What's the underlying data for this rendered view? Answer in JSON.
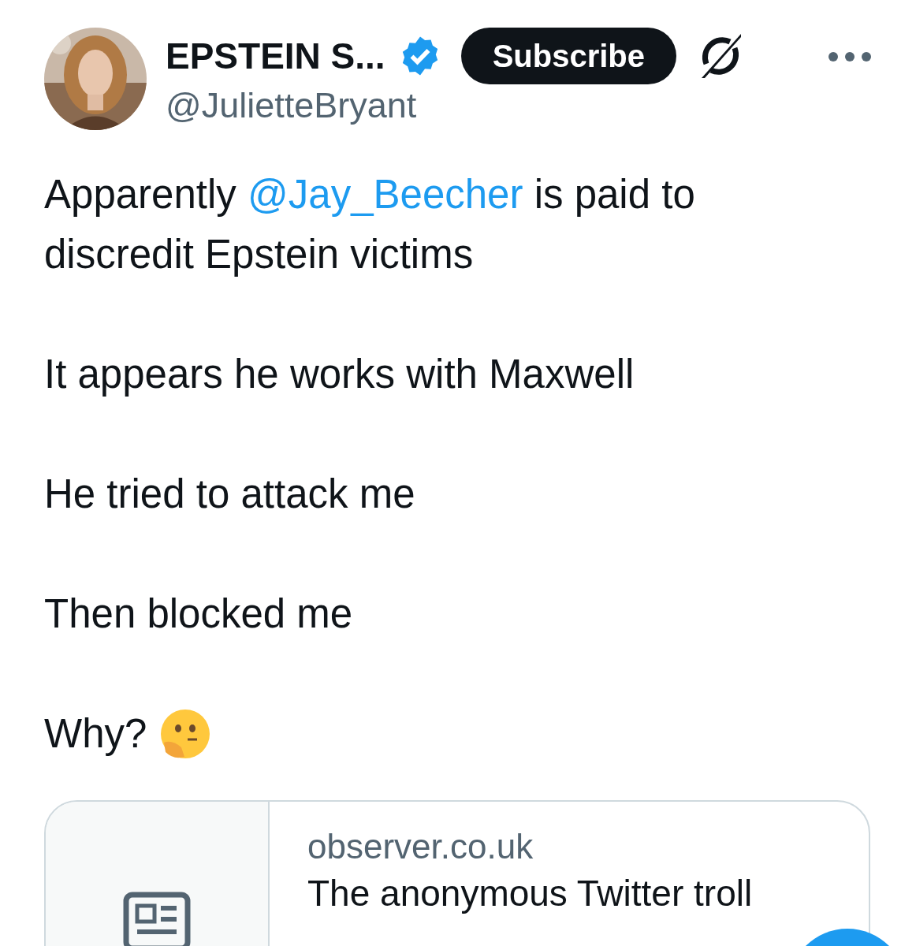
{
  "author": {
    "name": "EPSTEIN S...",
    "handle": "@JulietteBryant",
    "verified": true
  },
  "subscribe_button": "Subscribe",
  "paragraphs": [
    {
      "segments": [
        {
          "kind": "text",
          "text": "Apparently "
        },
        {
          "kind": "mention",
          "text": "@Jay_Beecher"
        },
        {
          "kind": "text",
          "text": " is paid to discredit Epstein victims"
        }
      ]
    },
    {
      "segments": [
        {
          "kind": "text",
          "text": "It appears he works with Maxwell"
        }
      ]
    },
    {
      "segments": [
        {
          "kind": "text",
          "text": "He tried to attack me"
        }
      ]
    },
    {
      "segments": [
        {
          "kind": "text",
          "text": "Then blocked me"
        }
      ]
    },
    {
      "segments": [
        {
          "kind": "text",
          "text": "Why?"
        },
        {
          "kind": "emoji"
        }
      ]
    }
  ],
  "link_card": {
    "domain": "observer.co.uk",
    "title": "The anonymous Twitter troll"
  }
}
